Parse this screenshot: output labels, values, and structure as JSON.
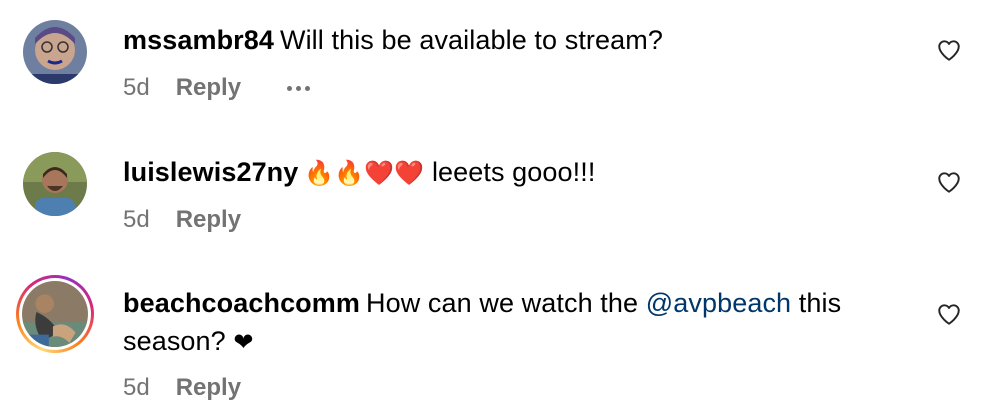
{
  "comments": [
    {
      "username": "mssambr84",
      "text": "Will this be available to stream?",
      "time": "5d",
      "reply_label": "Reply",
      "more_icon": "more-horizontal-icon",
      "like_icon": "heart-outline-icon"
    },
    {
      "username": "luislewis27ny",
      "emoji": "🔥🔥❤️❤️",
      "text": "leeets gooo!!!",
      "time": "5d",
      "reply_label": "Reply",
      "like_icon": "heart-outline-icon"
    },
    {
      "username": "beachcoachcomm",
      "text_before": "How can we watch the",
      "mention": "@avpbeach",
      "text_after": "this season?",
      "emoji": "❤",
      "time": "5d",
      "reply_label": "Reply",
      "like_icon": "heart-outline-icon"
    }
  ],
  "colors": {
    "secondary_text": "#737373",
    "mention": "#00376b",
    "story_ring": [
      "#feda75",
      "#fa7e1e",
      "#d62976",
      "#962fbf"
    ]
  }
}
